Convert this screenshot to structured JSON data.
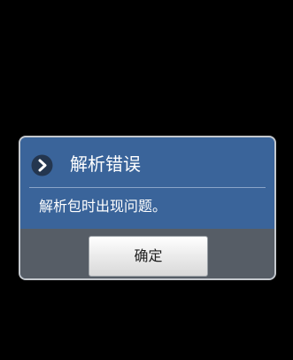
{
  "dialog": {
    "title": "解析错误",
    "message": "解析包时出现问题。",
    "icon": "chevron-right-circle-icon",
    "confirm_label": "确定"
  },
  "colors": {
    "screen_background": "#000000",
    "dialog_background": "#3a649a",
    "dialog_footer": "#565d66",
    "dialog_border": "#c4c8cd",
    "text": "#ffffff"
  }
}
